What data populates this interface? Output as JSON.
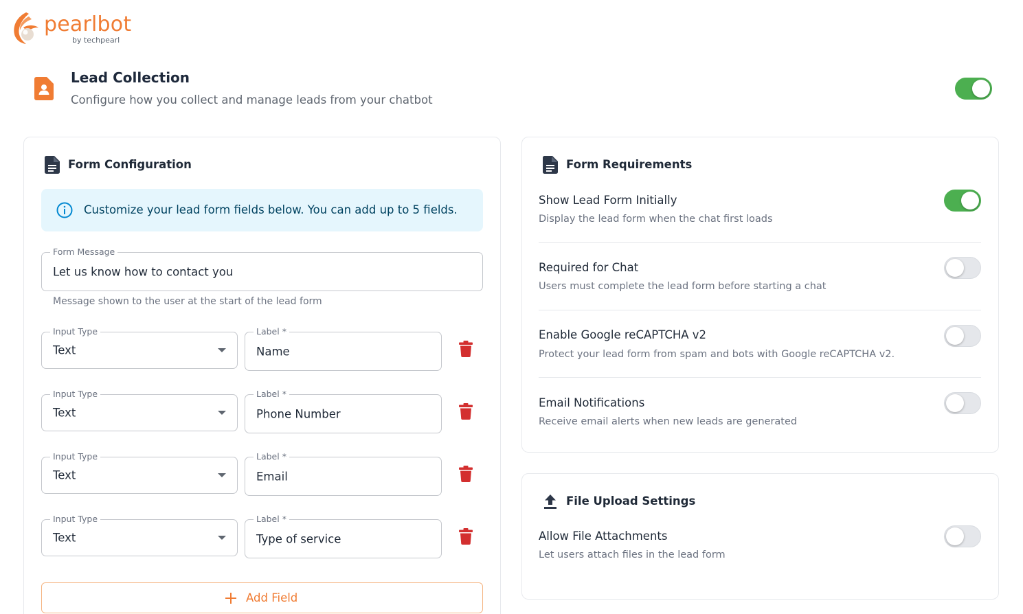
{
  "brand": {
    "name": "pearlbot",
    "tagline": "by techpearl",
    "accent": "#f07c33"
  },
  "header": {
    "title": "Lead Collection",
    "subtitle": "Configure how you collect and manage leads from your chatbot",
    "enabled": true,
    "icon": "contact-document-icon"
  },
  "form_configuration": {
    "title": "Form Configuration",
    "icon": "document-icon",
    "info": "Customize your lead form fields below. You can add up to 5 fields.",
    "form_message": {
      "label": "Form Message",
      "value": "Let us know how to contact you",
      "helper": "Message shown to the user at the start of the lead form"
    },
    "fields": [
      {
        "type_label": "Input Type",
        "type_value": "Text",
        "label_label": "Label *",
        "label_value": "Name"
      },
      {
        "type_label": "Input Type",
        "type_value": "Text",
        "label_label": "Label *",
        "label_value": "Phone Number"
      },
      {
        "type_label": "Input Type",
        "type_value": "Text",
        "label_label": "Label *",
        "label_value": "Email"
      },
      {
        "type_label": "Input Type",
        "type_value": "Text",
        "label_label": "Label *",
        "label_value": "Type of service"
      }
    ],
    "add_field_label": "Add Field"
  },
  "form_requirements": {
    "title": "Form Requirements",
    "icon": "document-icon",
    "items": [
      {
        "title": "Show Lead Form Initially",
        "description": "Display the lead form when the chat first loads",
        "enabled": true
      },
      {
        "title": "Required for Chat",
        "description": "Users must complete the lead form before starting a chat",
        "enabled": false
      },
      {
        "title": "Enable Google reCAPTCHA v2",
        "description": "Protect your lead form from spam and bots with Google reCAPTCHA v2.",
        "enabled": false
      },
      {
        "title": "Email Notifications",
        "description": "Receive email alerts when new leads are generated",
        "enabled": false
      }
    ]
  },
  "file_upload": {
    "title": "File Upload Settings",
    "icon": "upload-icon",
    "items": [
      {
        "title": "Allow File Attachments",
        "description": "Let users attach files in the lead form",
        "enabled": false
      }
    ]
  },
  "colors": {
    "toggle_on": "#4caf50",
    "delete": "#d32f2f",
    "info_bg": "#e5f6fd",
    "info_text": "#014361",
    "info_icon": "#0288d1"
  }
}
